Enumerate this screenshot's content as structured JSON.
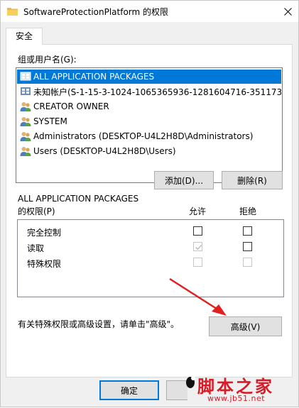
{
  "window": {
    "title": "SoftwareProtectionPlatform 的权限",
    "close_icon": "close-icon",
    "folder_icon": "folder-icon"
  },
  "tabs": [
    {
      "label": "安全",
      "active": true
    }
  ],
  "groups": {
    "label": "组或用户名(G):",
    "items": [
      {
        "name": "ALL APPLICATION PACKAGES",
        "icon": "package-group-icon",
        "selected": true
      },
      {
        "name": "未知帐户(S-1-15-3-1024-1065365936-1281604716-351173...",
        "icon": "unknown-account-icon",
        "selected": false
      },
      {
        "name": "CREATOR OWNER",
        "icon": "user-group-icon",
        "selected": false
      },
      {
        "name": "SYSTEM",
        "icon": "user-group-icon",
        "selected": false
      },
      {
        "name": "Administrators (DESKTOP-U4L2H8D\\Administrators)",
        "icon": "user-group-icon",
        "selected": false
      },
      {
        "name": "Users (DESKTOP-U4L2H8D\\Users)",
        "icon": "user-group-icon",
        "selected": false
      }
    ],
    "add_button": "添加(D)...",
    "remove_button": "删除(R)"
  },
  "permissions": {
    "for_label": "ALL APPLICATION PACKAGES",
    "title_label": "的权限(P)",
    "allow_header": "允许",
    "deny_header": "拒绝",
    "rows": [
      {
        "name": "完全控制",
        "allow": false,
        "allow_disabled": false,
        "deny": false,
        "deny_disabled": false
      },
      {
        "name": "读取",
        "allow": true,
        "allow_disabled": true,
        "deny": false,
        "deny_disabled": false
      },
      {
        "name": "特殊权限",
        "allow": false,
        "allow_disabled": true,
        "deny": false,
        "deny_disabled": true
      }
    ]
  },
  "advanced": {
    "hint": "有关特殊权限或高级设置，请单击\"高级\"。",
    "button": "高级(V)"
  },
  "footer": {
    "ok_button": "确定"
  },
  "watermark": {
    "title": "脚本之家",
    "url": "www.jb51.net"
  },
  "colors": {
    "selection": "#0078d7",
    "accent_arrow": "#e02020",
    "watermark": "#d81b26"
  }
}
